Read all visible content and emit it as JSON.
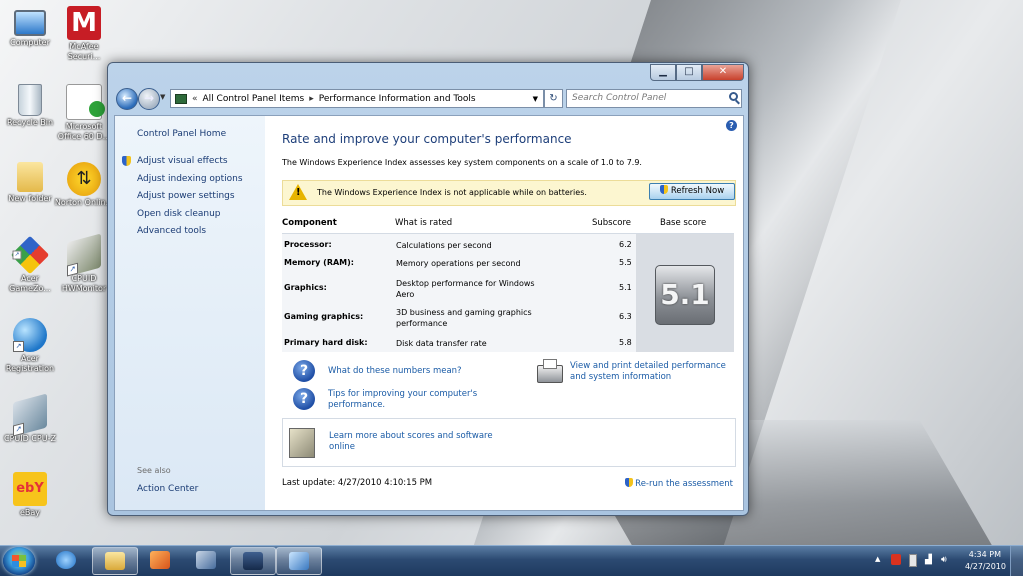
{
  "desktop": {
    "icons": [
      {
        "label": "Computer",
        "icon": "computer-icon"
      },
      {
        "label": "McAfee Securi...",
        "icon": "mcafee-icon"
      },
      {
        "label": "Recycle Bin",
        "icon": "recycle-bin-icon"
      },
      {
        "label": "Microsoft Office 60 D...",
        "icon": "office-icon"
      },
      {
        "label": "New folder",
        "icon": "folder-icon"
      },
      {
        "label": "Norton Onlin...",
        "icon": "norton-icon"
      },
      {
        "label": "Acer GameZo...",
        "icon": "acer-gamezone-icon"
      },
      {
        "label": "CPUID HWMonitor",
        "icon": "hwmonitor-icon"
      },
      {
        "label": "Acer Registration",
        "icon": "acer-registration-icon"
      },
      {
        "label": "CPUID CPU-Z",
        "icon": "cpuz-icon"
      },
      {
        "label": "eBay",
        "icon": "ebay-icon"
      }
    ]
  },
  "window": {
    "caption_buttons": {
      "minimize": "▁",
      "maximize": "□",
      "close": "✕"
    },
    "address": {
      "prefix": "«",
      "crumbs": [
        "All Control Panel Items",
        "Performance Information and Tools"
      ],
      "separator": "▸"
    },
    "search": {
      "placeholder": "Search Control Panel"
    },
    "left_pane": {
      "home": "Control Panel Home",
      "links": [
        "Adjust visual effects",
        "Adjust indexing options",
        "Adjust power settings",
        "Open disk cleanup",
        "Advanced tools"
      ],
      "see_also": "See also",
      "action_center": "Action Center"
    },
    "main": {
      "title": "Rate and improve your computer's performance",
      "description": "The Windows Experience Index assesses key system components on a scale of 1.0 to 7.9.",
      "infobar": {
        "message": "The Windows Experience Index is not applicable while on batteries.",
        "button": "Refresh Now"
      },
      "table": {
        "headers": {
          "component": "Component",
          "what_is_rated": "What is rated",
          "subscore": "Subscore",
          "base_score": "Base score"
        },
        "rows": [
          {
            "component": "Processor:",
            "rated": "Calculations per second",
            "subscore": "6.2"
          },
          {
            "component": "Memory (RAM):",
            "rated": "Memory operations per second",
            "subscore": "5.5"
          },
          {
            "component": "Graphics:",
            "rated": "Desktop performance for Windows Aero",
            "subscore": "5.1"
          },
          {
            "component": "Gaming graphics:",
            "rated": "3D business and gaming graphics performance",
            "subscore": "6.3"
          },
          {
            "component": "Primary hard disk:",
            "rated": "Disk data transfer rate",
            "subscore": "5.8"
          }
        ],
        "base_score": "5.1"
      },
      "links": {
        "what_numbers": "What do these numbers mean?",
        "tips": "Tips for improving your computer's performance.",
        "view_print": "View and print detailed performance and system information",
        "learn_more": "Learn more about scores and software online"
      },
      "last_update": "Last update: 4/27/2010 4:10:15 PM",
      "rerun": "Re-run the assessment"
    }
  },
  "taskbar": {
    "clock_time": "4:34 PM",
    "clock_date": "4/27/2010",
    "tray_arrow": "▲"
  },
  "colors": {
    "link": "#1a5ba6",
    "title": "#1e3f7a",
    "infobar": "#fcf6d0"
  }
}
